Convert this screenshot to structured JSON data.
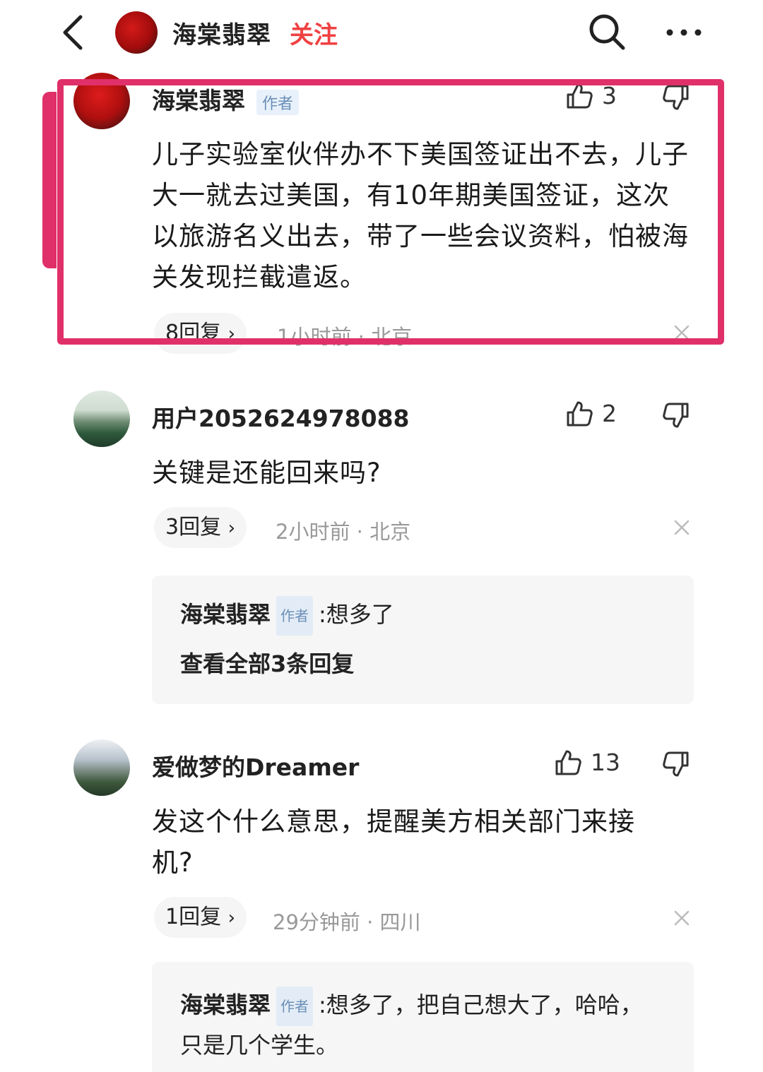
{
  "header": {
    "title": "海棠翡翠",
    "follow_label": "关注"
  },
  "comments": [
    {
      "username": "海棠翡翠",
      "badge": "作者",
      "likes": "3",
      "text": "儿子实验室伙伴办不下美国签证出不去，儿子大一就去过美国，有10年期美国签证，这次以旅游名义出去，带了一些会议资料，怕被海关发现拦截遣返。",
      "replies_label": "8回复",
      "meta": "1小时前 · 北京"
    },
    {
      "username": "用户2052624978088",
      "likes": "2",
      "text": "关键是还能回来吗?",
      "replies_label": "3回复",
      "meta": "2小时前 · 北京",
      "sub_reply": {
        "name": "海棠翡翠",
        "badge": "作者",
        "text": "想多了",
        "view_all": "查看全部3条回复"
      }
    },
    {
      "username": "爱做梦的Dreamer",
      "likes": "13",
      "text": "发这个什么意思，提醒美方相关部门来接机?",
      "replies_label": "1回复",
      "meta": "29分钟前 · 四川",
      "sub_reply": {
        "name": "海棠翡翠",
        "badge": "作者",
        "text": "想多了，把自己想大了，哈哈，只是几个学生。"
      }
    }
  ],
  "colors": {
    "accent_follow": "#f04142",
    "highlight": "#e0306a",
    "badge_text": "#6b8fb8"
  },
  "icons": [
    "back-arrow-icon",
    "search-icon",
    "more-icon",
    "thumbs-up-icon",
    "thumbs-down-icon",
    "close-icon",
    "chevron-right-icon"
  ]
}
